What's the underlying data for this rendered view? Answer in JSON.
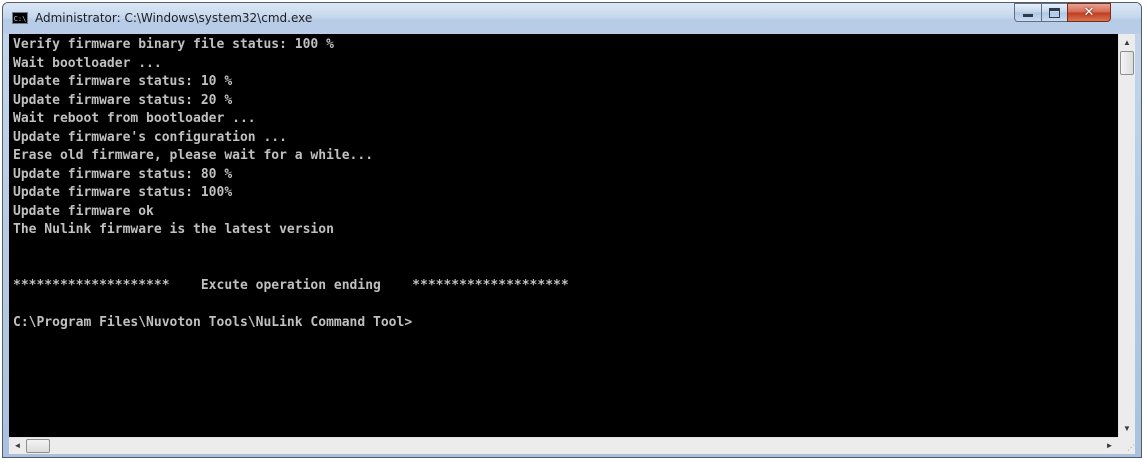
{
  "window": {
    "title": "Administrator: C:\\Windows\\system32\\cmd.exe",
    "icon": "cmd-icon",
    "icon_text": "C:\\"
  },
  "controls": {
    "minimize": "minimize-icon",
    "maximize": "maximize-icon",
    "close_glyph": "✕"
  },
  "console": {
    "text_color": "#c0c0c0",
    "background": "#000000",
    "lines": [
      "Verify firmware binary file status: 100 %",
      "Wait bootloader ...",
      "Update firmware status: 10 %",
      "Update firmware status: 20 %",
      "Wait reboot from bootloader ...",
      "Update firmware's configuration ...",
      "Erase old firmware, please wait for a while...",
      "Update firmware status: 80 %",
      "Update firmware status: 100%",
      "Update firmware ok",
      "The Nulink firmware is the latest version",
      "",
      "",
      "********************    Excute operation ending    ********************",
      "",
      "C:\\Program Files\\Nuvoton Tools\\NuLink Command Tool>"
    ]
  },
  "scrollbars": {
    "up": "▲",
    "down": "▼",
    "left": "◄",
    "right": "►",
    "grip": "⋰"
  }
}
